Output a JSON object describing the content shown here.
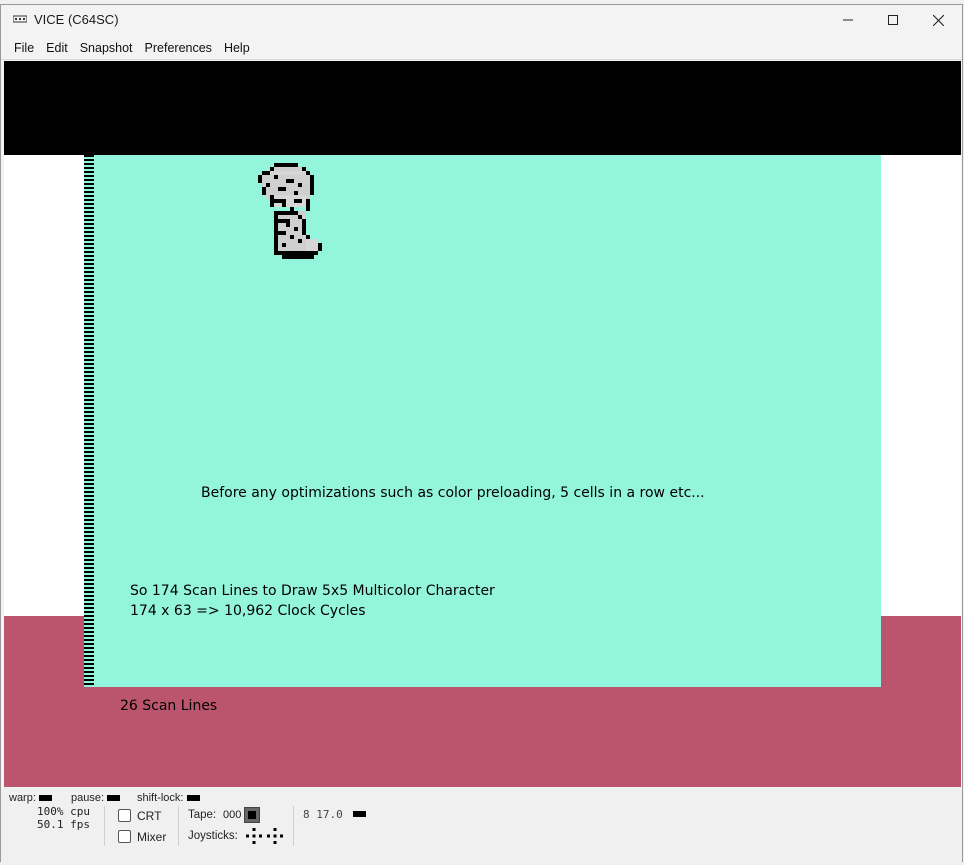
{
  "window": {
    "title": "VICE (C64SC)",
    "icons": {
      "app": "vice-app-icon",
      "minimize": "minimize-icon",
      "maximize": "maximize-icon",
      "close": "close-icon"
    }
  },
  "menu": {
    "items": [
      {
        "label": "File"
      },
      {
        "label": "Edit"
      },
      {
        "label": "Snapshot"
      },
      {
        "label": "Preferences"
      },
      {
        "label": "Help"
      }
    ]
  },
  "emulator": {
    "colors": {
      "border_top": "#000000",
      "border_bottom": "#bb546d",
      "background": "#93f5dc",
      "side_border": "#ffffff"
    },
    "sprite_icon": "pixel-character-sprite",
    "texts": {
      "line1": "Before any optimizations such as color preloading, 5 cells in a row etc...",
      "line2": "So 174 Scan Lines to Draw 5x5 Multicolor Character",
      "line3": "174 x 63 => 10,962 Clock Cycles",
      "line4": "26 Scan Lines"
    }
  },
  "status": {
    "warp_label": "warp:",
    "pause_label": "pause:",
    "shift_lock_label": "shift-lock:",
    "cpu": "100% cpu",
    "fps": "50.1 fps",
    "crt_label": "CRT",
    "mixer_label": "Mixer",
    "tape_label": "Tape:",
    "tape_counter": "000",
    "joysticks_label": "Joysticks:",
    "drive_status": "8 17.0"
  }
}
